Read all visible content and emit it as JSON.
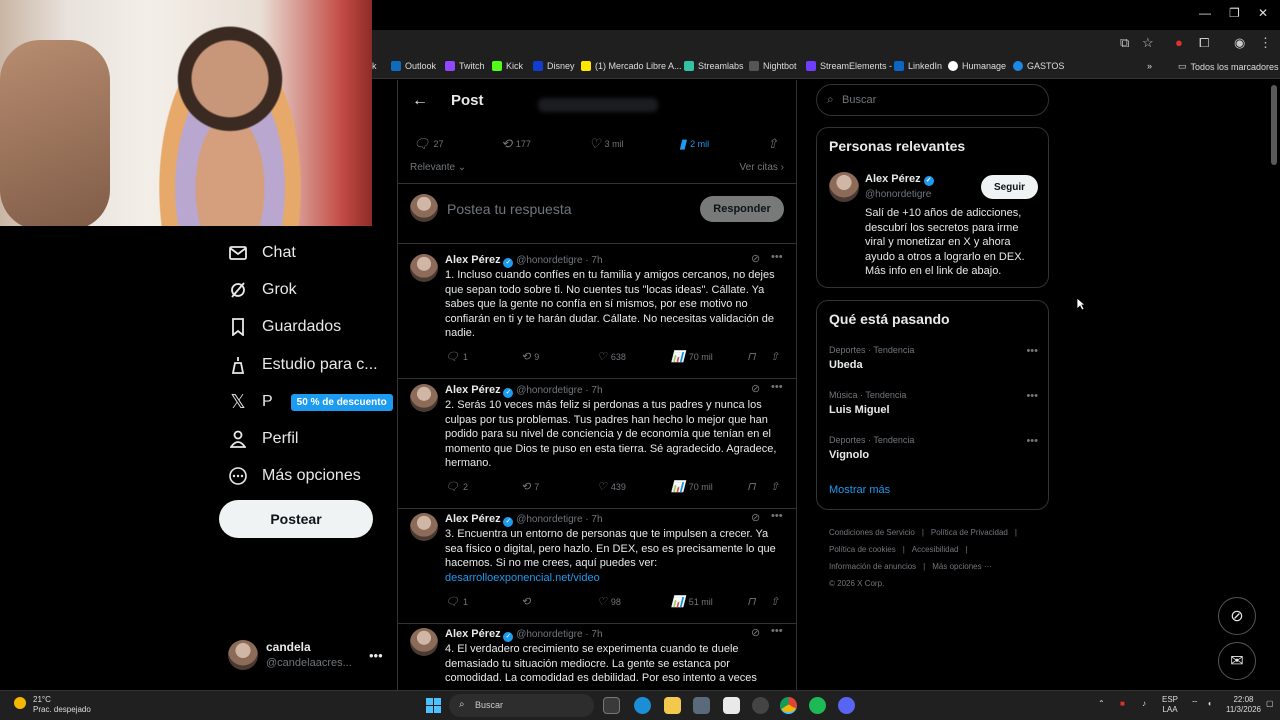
{
  "browser": {
    "bookmarks": [
      {
        "label": "k",
        "color": "#f0c020"
      },
      {
        "label": "Outlook",
        "color": "#0f6cbd"
      },
      {
        "label": "Twitch",
        "color": "#9146ff"
      },
      {
        "label": "Kick",
        "color": "#53fc18"
      },
      {
        "label": "Disney",
        "color": "#113ccf"
      },
      {
        "label": "(1) Mercado Libre A...",
        "color": "#ffe600"
      },
      {
        "label": "Streamlabs",
        "color": "#31c3a2"
      },
      {
        "label": "Nightbot",
        "color": "#222222"
      },
      {
        "label": "StreamElements -",
        "color": "#6f3dff"
      },
      {
        "label": "LinkedIn",
        "color": "#0a66c2"
      },
      {
        "label": "Humanage",
        "color": "#ffffff"
      },
      {
        "label": "GASTOS",
        "color": "#1e88e5"
      }
    ],
    "all_bookmarks": "Todos los marcadores"
  },
  "nav": {
    "items": [
      {
        "label": "Chat",
        "icon": "mail-icon"
      },
      {
        "label": "Grok",
        "icon": "grok-icon"
      },
      {
        "label": "Guardados",
        "icon": "bookmark-icon"
      },
      {
        "label": "Estudio para c...",
        "icon": "studio-icon"
      },
      {
        "label": "P",
        "icon": "x-logo-icon"
      },
      {
        "label": "Perfil",
        "icon": "person-icon"
      },
      {
        "label": "Más opciones",
        "icon": "more-icon"
      }
    ],
    "discount": "50 % de descuento",
    "post_button": "Postear",
    "account": {
      "name": "candela",
      "handle": "@candelaacres..."
    }
  },
  "post": {
    "title": "Post",
    "stats": {
      "replies": "27",
      "reposts": "177",
      "likes": "3 mil",
      "bookmarks": "2 mil"
    },
    "sort": "Relevante",
    "quotes": "Ver citas",
    "reply_placeholder": "Postea tu respuesta",
    "reply_button": "Responder"
  },
  "tweets": [
    {
      "name": "Alex Pérez",
      "handle": "@honordetigre",
      "time": "7h",
      "text": "1. Incluso cuando confíes en tu familia y amigos cercanos, no dejes que sepan todo sobre ti. No cuentes tus \"locas ideas\". Cállate. Ya sabes que la gente no confía en sí mismos, por ese motivo no confiarán en ti y te harán dudar. Cállate. No necesitas validación de nadie.",
      "link": "",
      "replies": "1",
      "reposts": "9",
      "likes": "638",
      "views": "70 mil"
    },
    {
      "name": "Alex Pérez",
      "handle": "@honordetigre",
      "time": "7h",
      "text": "2. Serás 10 veces más feliz si perdonas a tus padres y nunca los culpas por tus problemas. Tus padres han hecho lo mejor que han podido para su nivel de conciencia y de economía que tenían en el momento que Dios te puso en esta tierra. Sé agradecido. Agradece, hermano.",
      "link": "",
      "replies": "2",
      "reposts": "7",
      "likes": "439",
      "views": "70 mil"
    },
    {
      "name": "Alex Pérez",
      "handle": "@honordetigre",
      "time": "7h",
      "text": "3. Encuentra un entorno de personas que te impulsen a crecer. Ya sea físico o digital, pero hazlo. En DEX, eso es precisamente lo que hacemos. Si no me crees, aquí puedes ver:",
      "link": "desarrolloexponencial.net/video",
      "replies": "1",
      "reposts": "",
      "likes": "98",
      "views": "51 mil"
    },
    {
      "name": "Alex Pérez",
      "handle": "@honordetigre",
      "time": "7h",
      "text": "4. El verdadero crecimiento se experimenta cuando te duele demasiado tu situación mediocre. La gente se estanca por comodidad. La comodidad es debilidad. Por eso intento a veces",
      "link": "",
      "replies": "",
      "reposts": "",
      "likes": "",
      "views": ""
    }
  ],
  "sidebar": {
    "search_placeholder": "Buscar",
    "relevant": {
      "title": "Personas relevantes",
      "name": "Alex Pérez",
      "handle": "@honordetigre",
      "follow": "Seguir",
      "bio": "Salí de +10 años de adicciones, descubrí los secretos para irme viral y monetizar en X y ahora ayudo a otros a lograrlo en DEX. Más info en el link de abajo."
    },
    "trending": {
      "title": "Qué está pasando",
      "items": [
        {
          "category": "Deportes · Tendencia",
          "topic": "Ubeda"
        },
        {
          "category": "Música · Tendencia",
          "topic": "Luis Miguel"
        },
        {
          "category": "Deportes · Tendencia",
          "topic": "Vignolo"
        }
      ],
      "show_more": "Mostrar más"
    },
    "footer": [
      "Condiciones de Servicio",
      "|",
      "Política de Privacidad",
      "|",
      "Política de cookies",
      "|",
      "Accesibilidad",
      "|",
      "Información de anuncios",
      "|",
      "Más opciones ···",
      "© 2026 X Corp."
    ]
  },
  "taskbar": {
    "temp": "21°C",
    "weather": "Prac. despejado",
    "search": "Buscar",
    "lang1": "ESP",
    "lang2": "LAA",
    "time": "22:08",
    "date": "11/3/2026"
  },
  "colors": {
    "accent": "#1d9bf0",
    "background": "#000000",
    "border": "#2f3336",
    "muted": "#71767b"
  }
}
